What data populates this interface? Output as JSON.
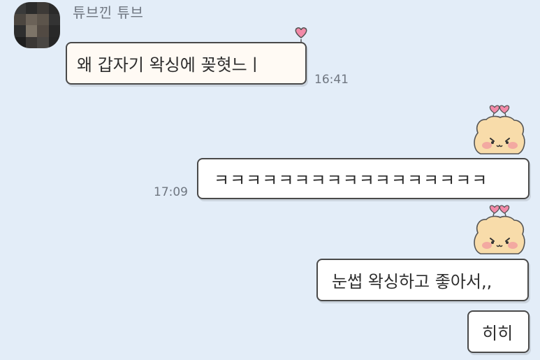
{
  "sender": {
    "name": "튜브낀 튜브"
  },
  "messages": [
    {
      "text": "왜 갑자기 왁싱에 꽂혓느ㅣ",
      "time": "16:41"
    },
    {
      "text": "ㅋㅋㅋㅋㅋㅋㅋㅋㅋㅋㅋㅋㅋㅋㅋㅋㅋ",
      "time": "17:09"
    },
    {
      "text": "눈썹 왁싱하고 좋아서,,"
    },
    {
      "text": "히히"
    }
  ],
  "colors": {
    "background": "#e3edf8",
    "bubble_border": "#494949",
    "heart": "#f28aa8",
    "bear_fur": "#f8dcaa",
    "blush": "#f2a0a0"
  },
  "icons": [
    "heart-icon",
    "bear-sticker-icon"
  ]
}
